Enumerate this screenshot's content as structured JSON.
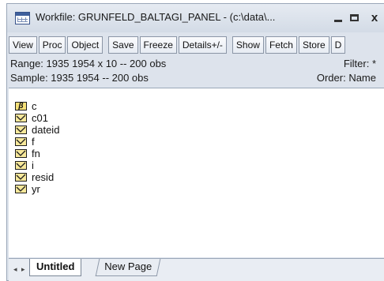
{
  "window": {
    "title": "Workfile: GRUNFELD_BALTAGI_PANEL - (c:\\data\\...",
    "controls": {
      "minimize": "_",
      "maximize": "▭",
      "close": "x"
    }
  },
  "toolbar": {
    "buttons": [
      "View",
      "Proc",
      "Object",
      "Save",
      "Freeze",
      "Details+/-",
      "Show",
      "Fetch",
      "Store",
      "D"
    ]
  },
  "info": {
    "range": "Range:  1935 1954 x 10  --  200 obs",
    "filter": "Filter: *",
    "sample": "Sample: 1935 1954  --  200 obs",
    "order": "Order: Name"
  },
  "objects": [
    {
      "name": "c",
      "icon": "coef-vector-icon",
      "glyph": "β"
    },
    {
      "name": "c01",
      "icon": "series-icon"
    },
    {
      "name": "dateid",
      "icon": "series-icon"
    },
    {
      "name": "f",
      "icon": "series-icon"
    },
    {
      "name": "fn",
      "icon": "series-icon"
    },
    {
      "name": "i",
      "icon": "series-icon"
    },
    {
      "name": "resid",
      "icon": "series-icon"
    },
    {
      "name": "yr",
      "icon": "series-icon"
    }
  ],
  "tabs": {
    "nav_left": "◂",
    "nav_right": "▸",
    "active": "Untitled",
    "inactive": "New Page"
  }
}
